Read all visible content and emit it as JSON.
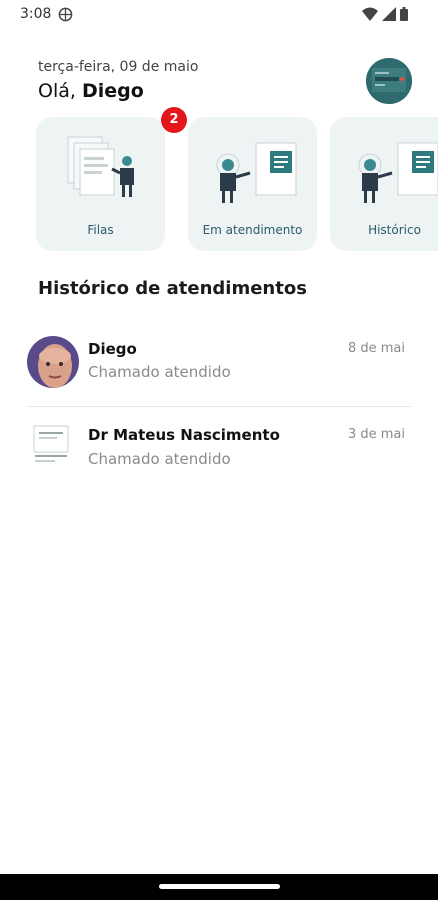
{
  "status_bar": {
    "time": "3:08",
    "icons": [
      "vpn-globe-icon",
      "wifi-icon",
      "signal-icon",
      "battery-icon"
    ]
  },
  "header": {
    "date": "terça-feira, 09 de maio",
    "greeting_prefix": "Olá,",
    "user_name": "Diego"
  },
  "cards": [
    {
      "label": "Filas",
      "badge": "2"
    },
    {
      "label": "Em atendimento"
    },
    {
      "label": "Histórico"
    }
  ],
  "section_title": "Histórico de atendimentos",
  "history": [
    {
      "name": "Diego",
      "status": "Chamado atendido",
      "date": "8 de mai"
    },
    {
      "name": "Dr Mateus Nascimento",
      "status": "Chamado atendido",
      "date": "3 de mai"
    }
  ],
  "colors": {
    "accent": "#2b5b6a",
    "card_bg": "#eef3f4",
    "badge": "#e3161b"
  }
}
